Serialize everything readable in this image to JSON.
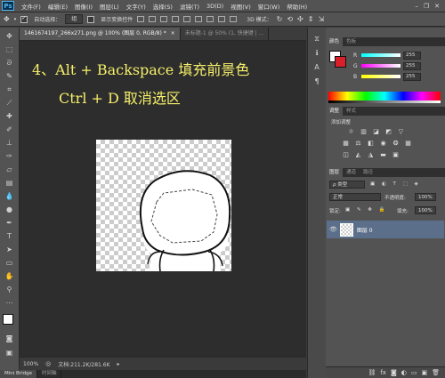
{
  "app": {
    "logo": "Ps"
  },
  "menu": [
    "文件(F)",
    "编辑(E)",
    "图像(I)",
    "图层(L)",
    "文字(Y)",
    "选择(S)",
    "滤镜(T)",
    "3D(D)",
    "视图(V)",
    "窗口(W)",
    "帮助(H)"
  ],
  "window_controls": {
    "minimize": "–",
    "restore": "❐",
    "close": "✕"
  },
  "options": {
    "auto_select_label": "自动选择：",
    "auto_select_value": "组",
    "show_transform_label": "显示变换控件",
    "mode_3d_label": "3D 模式："
  },
  "doc_tabs": [
    {
      "label": "1461674197_266x271.png @ 100% (图层 0, RGB/8) *",
      "close": "×"
    },
    {
      "label": "未标题-1 @ 50% (1, 快捷键 | ..."
    }
  ],
  "canvas": {
    "instruction1": "4、Alt + Backspace   填充前景色",
    "instruction2": "Ctrl + D   取消选区"
  },
  "status": {
    "zoom": "100%",
    "doc_info": "文档:211.2K/281.6K"
  },
  "bottom_tabs": [
    "Mini Bridge",
    "时间轴"
  ],
  "color_panel": {
    "tabs": [
      "颜色",
      "色板"
    ],
    "channels": [
      {
        "label": "R",
        "value": "255"
      },
      {
        "label": "G",
        "value": "255"
      },
      {
        "label": "B",
        "value": "255"
      }
    ]
  },
  "adjust_panel": {
    "tabs": [
      "调整",
      "样式"
    ],
    "title": "添加调整"
  },
  "layers_panel": {
    "tabs": [
      "图层",
      "通道",
      "路径"
    ],
    "filter_label": "ρ 类型",
    "blend_mode": "正常",
    "opacity_label": "不透明度:",
    "opacity_value": "100%",
    "lock_label": "锁定:",
    "fill_label": "填充:",
    "fill_value": "100%",
    "layer_name": "图层 0"
  },
  "colors": {
    "foreground": "#ffffff",
    "background": "#d8202a",
    "instruction_text": "#f5ef6a",
    "selected_layer": "#5c6f8a"
  }
}
